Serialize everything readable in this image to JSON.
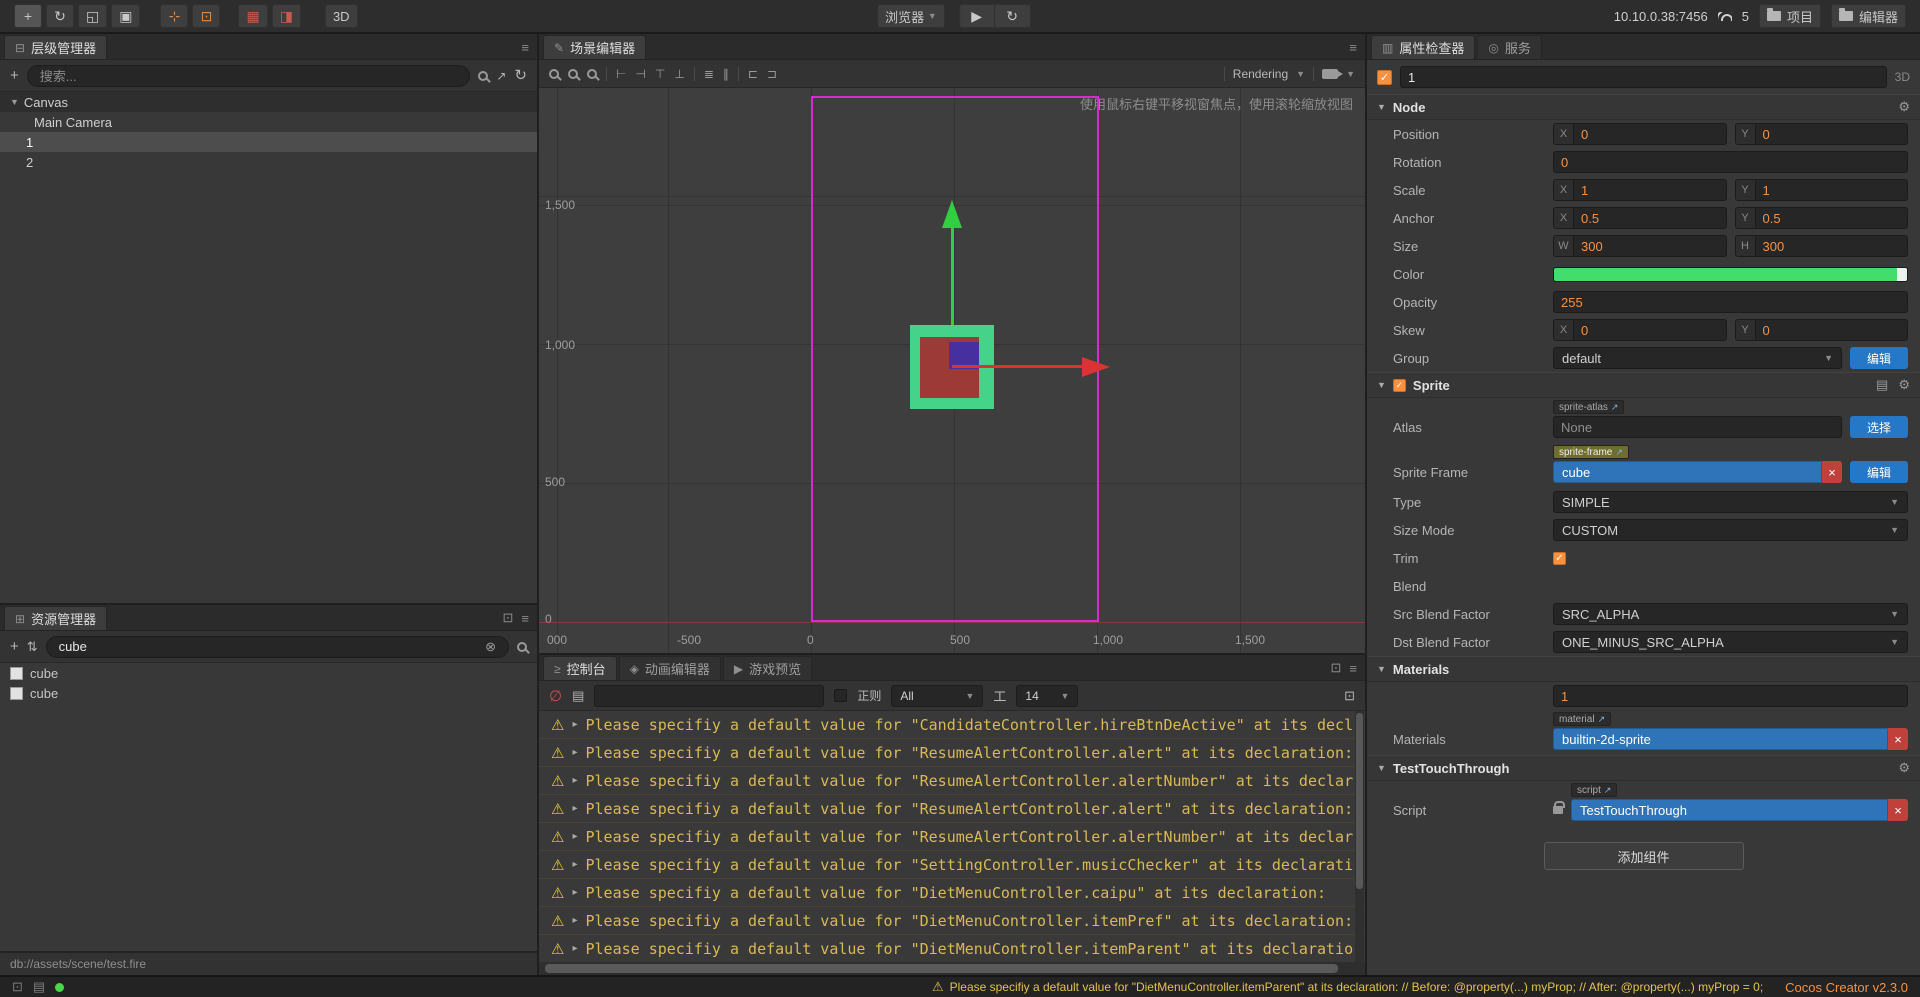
{
  "colors": {
    "accent_orange": "#f79243",
    "blue_button": "#2577c8",
    "selected_asset_blue": "#2f74b9",
    "design_border_magenta": "#d42bd4",
    "sprite_green": "#45d389",
    "sprite_inner_red": "#9c3a38",
    "sprite_inner_purple": "#4630a0",
    "gizmo_green": "#2fcf3f",
    "gizmo_red": "#d83434",
    "console_warning_yellow": "#d9b954",
    "node_color_value": "#42dd6b",
    "version_orange": "#f79243"
  },
  "icons": {
    "menu": "≡",
    "plus": "+",
    "caret_down": "▼",
    "expander": "▸",
    "refresh": "↻",
    "expand_link": "↗",
    "clear": "⊗",
    "ban": "∅",
    "warning": "⚠",
    "gear": "⚙",
    "check": "✓",
    "close": "×",
    "popout": "⊡",
    "doc": "▤",
    "sort": "⇅",
    "hierarchy": "⊟",
    "assets": "⊞",
    "scene": "✎",
    "console": "≥",
    "animation": "◈",
    "preview": "▶",
    "inspector": "▥",
    "services": "◎",
    "move": "+",
    "rotate": "↻",
    "scale": "◱",
    "rect": "▣",
    "gizmo1": "⊹",
    "gizmo2": "⊡",
    "gizmo3": "▦",
    "gizmo4": "◨",
    "play": "▶",
    "font": "工"
  },
  "topbar": {
    "mode_3d": "3D",
    "browser": "浏览器",
    "ip": "10.10.0.38:7456",
    "signal_count": "5",
    "project": "项目",
    "editor": "编辑器"
  },
  "hierarchy": {
    "tab": "层级管理器",
    "search_placeholder": "搜索...",
    "tree": [
      {
        "label": "Canvas"
      },
      {
        "label": "Main Camera"
      },
      {
        "label": "1"
      },
      {
        "label": "2"
      }
    ]
  },
  "assets": {
    "tab": "资源管理器",
    "search_value": "cube",
    "items": [
      {
        "label": "cube"
      },
      {
        "label": "cube"
      }
    ],
    "path": "db://assets/scene/test.fire"
  },
  "scene": {
    "tab": "场景编辑器",
    "rendering": "Rendering",
    "hint": "使用鼠标右键平移视窗焦点，使用滚轮缩放视图",
    "ruler_y": [
      "1,500",
      "1,000",
      "500",
      "0"
    ],
    "ruler_x": [
      "000",
      "-500",
      "0",
      "500",
      "1,000",
      "1,500"
    ],
    "align_icons": [
      "⊢",
      "⊣",
      "⊤",
      "⊥",
      "≣",
      "∥",
      "⊏",
      "⊐"
    ]
  },
  "console": {
    "tab_console": "控制台",
    "tab_animation": "动画编辑器",
    "tab_preview": "游戏预览",
    "regex_label": "正则",
    "filter_value": "All",
    "font_size": "14",
    "logs": [
      "Please specifiy a default value for \"CandidateController.hireBtnDeActive\" at its declaration:",
      "Please specifiy a default value for \"ResumeAlertController.alert\" at its declaration:",
      "Please specifiy a default value for \"ResumeAlertController.alertNumber\" at its declaration:",
      "Please specifiy a default value for \"ResumeAlertController.alert\" at its declaration:",
      "Please specifiy a default value for \"ResumeAlertController.alertNumber\" at its declaration:",
      "Please specifiy a default value for \"SettingController.musicChecker\" at its declaration:",
      "Please specifiy a default value for \"DietMenuController.caipu\" at its declaration:",
      "Please specifiy a default value for \"DietMenuController.itemPref\" at its declaration:",
      "Please specifiy a default value for \"DietMenuController.itemParent\" at its declaration:"
    ]
  },
  "inspector": {
    "tab_properties": "属性检查器",
    "tab_services": "服务",
    "name_value": "1",
    "badge_3d": "3D",
    "axis_x": "X",
    "axis_y": "Y",
    "axis_w": "W",
    "axis_h": "H",
    "node": {
      "title": "Node",
      "position_label": "Position",
      "position_x": "0",
      "position_y": "0",
      "rotation_label": "Rotation",
      "rotation": "0",
      "scale_label": "Scale",
      "scale_x": "1",
      "scale_y": "1",
      "anchor_label": "Anchor",
      "anchor_x": "0.5",
      "anchor_y": "0.5",
      "size_label": "Size",
      "size_w": "300",
      "size_h": "300",
      "color_label": "Color",
      "opacity_label": "Opacity",
      "opacity": "255",
      "skew_label": "Skew",
      "skew_x": "0",
      "skew_y": "0",
      "group_label": "Group",
      "group_value": "default",
      "edit_button": "编辑"
    },
    "sprite": {
      "title": "Sprite",
      "atlas_label": "Atlas",
      "atlas_chip": "sprite-atlas",
      "atlas_value": "None",
      "select_button": "选择",
      "frame_label": "Sprite Frame",
      "frame_chip": "sprite-frame",
      "frame_value": "cube",
      "edit_button": "编辑",
      "type_label": "Type",
      "type_value": "SIMPLE",
      "sizemode_label": "Size Mode",
      "sizemode_value": "CUSTOM",
      "trim_label": "Trim",
      "blend_label": "Blend",
      "src_label": "Src Blend Factor",
      "src_value": "SRC_ALPHA",
      "dst_label": "Dst Blend Factor",
      "dst_value": "ONE_MINUS_SRC_ALPHA"
    },
    "materials": {
      "title": "Materials",
      "count": "1",
      "label": "Materials",
      "chip": "material",
      "value": "builtin-2d-sprite"
    },
    "script_section": {
      "title": "TestTouchThrough",
      "label": "Script",
      "chip": "script",
      "value": "TestTouchThrough"
    },
    "add_component": "添加组件"
  },
  "statusbar": {
    "warning": "Please specifiy a default value for \"DietMenuController.itemParent\" at its declaration: // Before: @property(...) myProp; // After: @property(...) myProp = 0;",
    "version": "Cocos Creator v2.3.0"
  }
}
